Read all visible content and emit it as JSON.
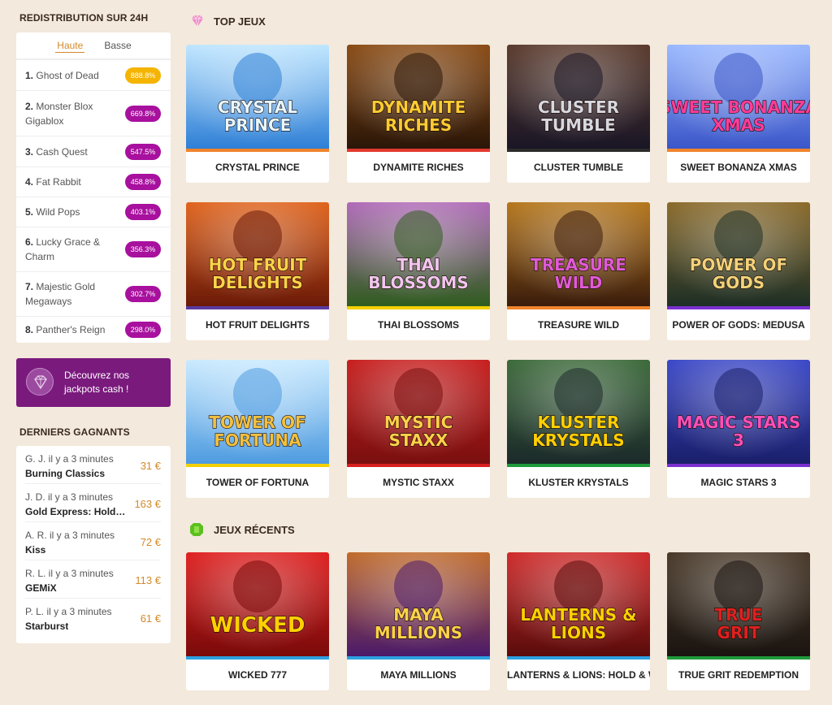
{
  "sidebar": {
    "redistribution": {
      "title": "REDISTRIBUTION SUR 24H",
      "tabs": [
        {
          "label": "Haute",
          "active": true
        },
        {
          "label": "Basse",
          "active": false
        }
      ],
      "items": [
        {
          "rank": "1.",
          "name": "Ghost of Dead",
          "pct": "888.8%",
          "highlight": true
        },
        {
          "rank": "2.",
          "name": "Monster Blox Gigablox",
          "pct": "669.8%",
          "highlight": false
        },
        {
          "rank": "3.",
          "name": "Cash Quest",
          "pct": "547.5%",
          "highlight": false
        },
        {
          "rank": "4.",
          "name": "Fat Rabbit",
          "pct": "458.8%",
          "highlight": false
        },
        {
          "rank": "5.",
          "name": "Wild Pops",
          "pct": "403.1%",
          "highlight": false
        },
        {
          "rank": "6.",
          "name": "Lucky Grace & Charm",
          "pct": "356.3%",
          "highlight": false
        },
        {
          "rank": "7.",
          "name": "Majestic Gold Megaways",
          "pct": "302.7%",
          "highlight": false
        },
        {
          "rank": "8.",
          "name": "Panther's Reign",
          "pct": "298.0%",
          "highlight": false
        }
      ]
    },
    "jackpot_banner": {
      "text": "Découvrez nos jackpots cash !"
    },
    "winners": {
      "title": "DERNIERS GAGNANTS",
      "items": [
        {
          "meta": "G. J. il y a 3 minutes",
          "game": "Burning Classics",
          "amount": "31 €"
        },
        {
          "meta": "J. D. il y a 3 minutes",
          "game": "Gold Express: Hold and Win",
          "amount": "163 €"
        },
        {
          "meta": "A. R. il y a 3 minutes",
          "game": "Kiss",
          "amount": "72 €"
        },
        {
          "meta": "R. L. il y a 3 minutes",
          "game": "GEMiX",
          "amount": "113 €"
        },
        {
          "meta": "P. L. il y a 3 minutes",
          "game": "Starburst",
          "amount": "61 €"
        }
      ]
    }
  },
  "top_games": {
    "title": "TOP JEUX",
    "games": [
      {
        "title": "CRYSTAL PRINCE",
        "art": "CRYSTAL PRINCE",
        "bg1": "#2e7fd6",
        "bg2": "#bfe6ff",
        "band": "#f0842c",
        "textColor": "#e8f6ff"
      },
      {
        "title": "DYNAMITE RICHES",
        "art": "DYNAMITE RICHES",
        "bg1": "#2a1608",
        "bg2": "#8a4b14",
        "band": "#e0392f",
        "textColor": "#ffcc33"
      },
      {
        "title": "CLUSTER TUMBLE",
        "art": "CLUSTER TUMBLE",
        "bg1": "#1a1626",
        "bg2": "#5a3a2c",
        "band": "#2b2b2b",
        "textColor": "#d8d8e0"
      },
      {
        "title": "SWEET BONANZA XMAS",
        "art": "SWEET BONANZA XMAS",
        "bg1": "#3a56c9",
        "bg2": "#9ab8ff",
        "band": "#f0842c",
        "textColor": "#ff3c9a"
      },
      {
        "title": "HOT FRUIT DELIGHTS",
        "art": "HOT FRUIT DELIGHTS",
        "bg1": "#6b1a08",
        "bg2": "#e0631c",
        "band": "#5a3aa0",
        "textColor": "#ffd34a"
      },
      {
        "title": "THAI BLOSSOMS",
        "art": "THAI BLOSSOMS",
        "bg1": "#2f5d1e",
        "bg2": "#b06ab8",
        "band": "#f5d000",
        "textColor": "#f2c6f0"
      },
      {
        "title": "TREASURE WILD",
        "art": "TREASURE WILD",
        "bg1": "#3a1c0c",
        "bg2": "#b5761a",
        "band": "#f0842c",
        "textColor": "#e05ad8"
      },
      {
        "title": "POWER OF GODS: MEDUSA",
        "art": "POWER OF GODS",
        "bg1": "#1d2f26",
        "bg2": "#8a6a2a",
        "band": "#7a2fd0",
        "textColor": "#f3d27a"
      },
      {
        "title": "TOWER OF FORTUNA",
        "art": "TOWER OF FORTUNA",
        "bg1": "#4e9be0",
        "bg2": "#c9eaff",
        "band": "#f5d000",
        "textColor": "#f2c040"
      },
      {
        "title": "MYSTIC STAXX",
        "art": "MYSTIC STAXX",
        "bg1": "#7a0f0f",
        "bg2": "#c81e1e",
        "band": "#d81e1e",
        "textColor": "#ffd24a"
      },
      {
        "title": "KLUSTER KRYSTALS",
        "art": "KLUSTER KRYSTALS",
        "bg1": "#1c2a2a",
        "bg2": "#3c6a3a",
        "band": "#1e9a3a",
        "textColor": "#ffd000"
      },
      {
        "title": "MAGIC STARS 3",
        "art": "MAGIC STARS 3",
        "bg1": "#1a1f6a",
        "bg2": "#3b48c8",
        "band": "#7a2fd0",
        "textColor": "#ff4fb8"
      }
    ]
  },
  "recent_games": {
    "title": "JEUX RÉCENTS",
    "games": [
      {
        "title": "WICKED 777",
        "art": "WICKED",
        "bg1": "#7a0a0a",
        "bg2": "#e02020",
        "band": "#2ca0e0",
        "textColor": "#ffd000"
      },
      {
        "title": "MAYA MILLIONS",
        "art": "MAYA MILLIONS",
        "bg1": "#4a1a6a",
        "bg2": "#c06a2a",
        "band": "#2ca0e0",
        "textColor": "#ffd34a"
      },
      {
        "title": "LANTERNS & LIONS: HOLD & WIN",
        "art": "LANTERNS & LIONS",
        "bg1": "#5a0c0c",
        "bg2": "#d02a2a",
        "band": "#2ca0e0",
        "textColor": "#ffd000"
      },
      {
        "title": "TRUE GRIT REDEMPTION",
        "art": "TRUE GRIT",
        "bg1": "#1a1410",
        "bg2": "#4a3a2a",
        "band": "#1e9a3a",
        "textColor": "#e02020"
      }
    ]
  }
}
